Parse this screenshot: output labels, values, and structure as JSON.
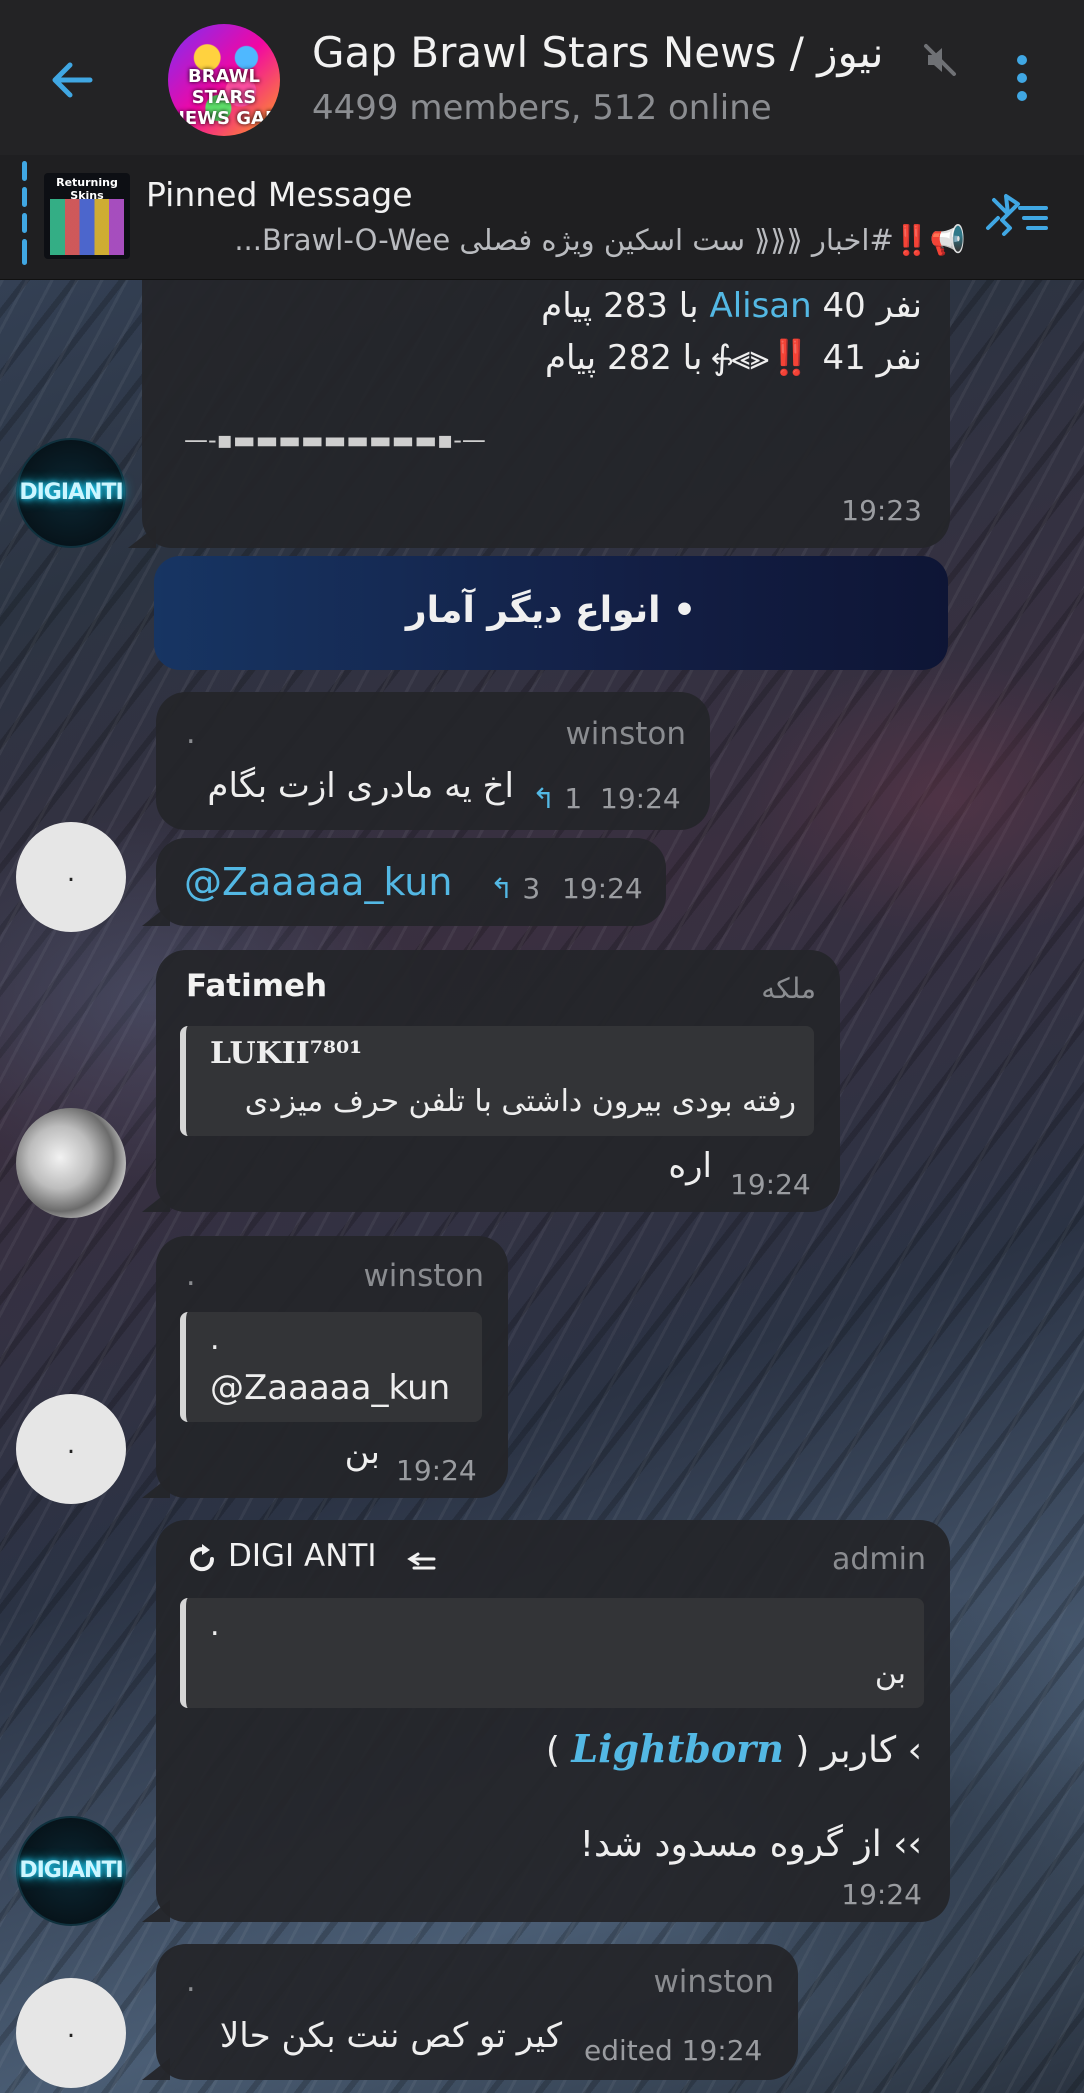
{
  "header": {
    "title": "Gap Brawl Stars News / نیوز",
    "status": "4499 members, 512 online",
    "avatar_text": "BRAWL STARS NEWS GAP"
  },
  "pinned": {
    "title": "Pinned Message",
    "text": "📢‼️#اخبار ⟪⟪⟪ ست اسکین ویژه فصلی Brawl-O-Wee...",
    "thumb_title": "Returning Skins"
  },
  "messages": {
    "m1": {
      "line1": "نفر 40 Alisan با 283 پیام",
      "line1_name": "Alisan",
      "line2": "نفر 41 ‼️⪡⪢⨗ با 282 پیام",
      "divider": "—-▪▬▬▬▬▬▬▬▬▬▪-—",
      "time": "19:23",
      "avatar_text": "DIGIANTI"
    },
    "banner": "• انواع دیگر آمار",
    "m2": {
      "sender": "winston",
      "role": ".",
      "text": "اخ یه مادری ازت بگام",
      "replies": "1",
      "time": "19:24"
    },
    "m3": {
      "text": "@Zaaaaa_kun",
      "replies": "3",
      "time": "19:24",
      "avatar_text": "."
    },
    "m4": {
      "sender": "Fatimeh",
      "role": "ملکه",
      "quote_author": "LUKII⁷⁸⁰¹",
      "quote_text": "رفته بودی بیرون داشتی با تلفن حرف میزدی",
      "text": "اره",
      "time": "19:24"
    },
    "m5": {
      "sender": "winston",
      "role": ".",
      "quote_author": ".",
      "quote_text": "@Zaaaaa_kun",
      "text": "بن",
      "time": "19:24",
      "avatar_text": "."
    },
    "m6": {
      "sender": "DIGI ANTI",
      "role": "admin",
      "quote_author": ".",
      "quote_text": "بن",
      "line1_pre": "› کاربر (",
      "line1_name": "Lightborn",
      "line1_post": ")",
      "line2": "›› از گروه مسدود شد!",
      "time": "19:24",
      "avatar_text": "DIGIANTI"
    },
    "m7": {
      "sender": "winston",
      "role": ".",
      "text": "کیر تو کص ننت بکن حالا",
      "time": "edited 19:24",
      "avatar_text": "."
    }
  },
  "colors": {
    "accent": "#40a7e3",
    "link": "#53b8e4",
    "bubble": "#242529"
  }
}
